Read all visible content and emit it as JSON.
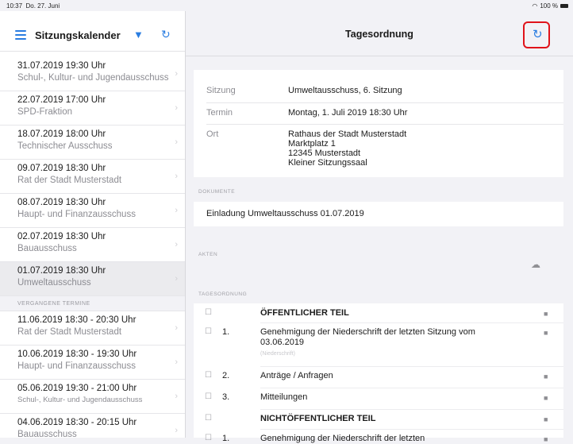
{
  "status": {
    "time": "10:37",
    "date": "Do. 27. Juni",
    "battery": "100 %"
  },
  "sidebar": {
    "title": "Sitzungskalender",
    "upcoming": [
      {
        "date": "31.07.2019 19:30 Uhr",
        "committee": "Schul-, Kultur- und Jugendausschuss"
      },
      {
        "date": "22.07.2019 17:00 Uhr",
        "committee": "SPD-Fraktion"
      },
      {
        "date": "18.07.2019 18:00 Uhr",
        "committee": "Technischer Ausschuss"
      },
      {
        "date": "09.07.2019 18:30 Uhr",
        "committee": "Rat der Stadt Musterstadt"
      },
      {
        "date": "08.07.2019 18:30 Uhr",
        "committee": "Haupt- und Finanzausschuss"
      },
      {
        "date": "02.07.2019 18:30 Uhr",
        "committee": "Bauausschuss"
      },
      {
        "date": "01.07.2019 18:30 Uhr",
        "committee": "Umweltausschuss"
      }
    ],
    "past_label": "VERGANGENE TERMINE",
    "past": [
      {
        "date": "11.06.2019 18:30 - 20:30 Uhr",
        "committee": "Rat der Stadt Musterstadt"
      },
      {
        "date": "10.06.2019 18:30 - 19:30 Uhr",
        "committee": "Haupt- und Finanzausschuss"
      },
      {
        "date": "05.06.2019 19:30 - 21:00 Uhr",
        "committee": "Schul-, Kultur- und Jugendausschuss"
      },
      {
        "date": "04.06.2019 18:30 - 20:15 Uhr",
        "committee": "Bauausschuss"
      }
    ]
  },
  "main": {
    "title": "Tagesordnung",
    "info": {
      "sitzung_label": "Sitzung",
      "sitzung": "Umweltausschuss, 6. Sitzung",
      "termin_label": "Termin",
      "termin": "Montag, 1. Juli 2019 18:30 Uhr",
      "ort_label": "Ort",
      "ort_lines": [
        "Rathaus der Stadt Musterstadt",
        "Marktplatz 1",
        "12345 Musterstadt",
        "Kleiner Sitzungssaal"
      ]
    },
    "dokumente_label": "DOKUMENTE",
    "dokument": "Einladung Umweltausschuss 01.07.2019",
    "akten_label": "AKTEN",
    "tagesordnung_label": "TAGESORDNUNG",
    "items": [
      {
        "num": "",
        "title": "ÖFFENTLICHER TEIL",
        "bold": true
      },
      {
        "num": "1.",
        "title": "Genehmigung der Niederschrift der letzten Sitzung vom 03.06.2019",
        "sub": "(Niederschrift)"
      },
      {
        "num": "2.",
        "title": "Anträge / Anfragen"
      },
      {
        "num": "3.",
        "title": "Mitteilungen"
      },
      {
        "num": "",
        "title": "NICHTÖFFENTLICHER TEIL",
        "bold": true
      },
      {
        "num": "1.",
        "title": "Genehmigung der Niederschrift der letzten"
      }
    ]
  },
  "colors": {
    "accent": "#2a7de1",
    "highlight": "#e0131a"
  }
}
